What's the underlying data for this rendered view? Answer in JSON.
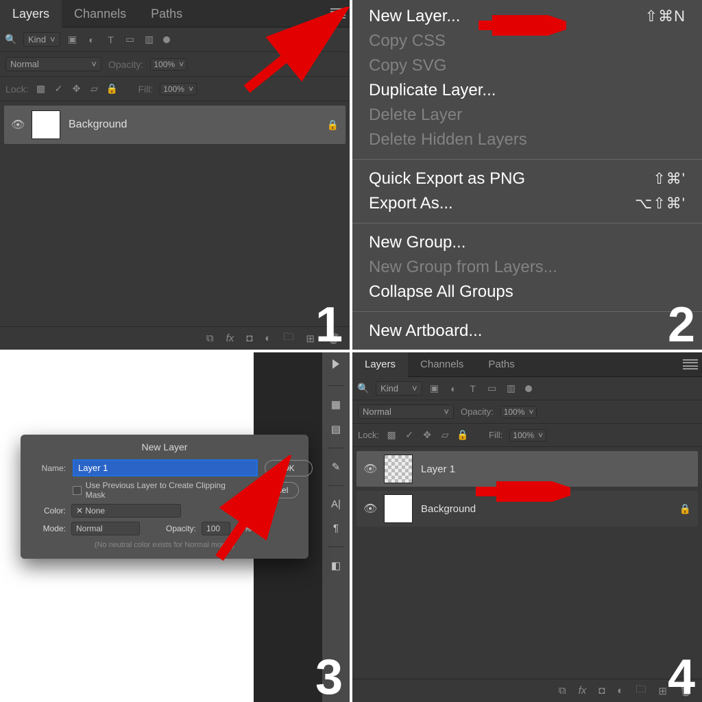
{
  "step_numbers": [
    "1",
    "2",
    "3",
    "4"
  ],
  "panel": {
    "tabs": {
      "layers": "Layers",
      "channels": "Channels",
      "paths": "Paths"
    },
    "filter": {
      "label": "Kind"
    },
    "blend": {
      "mode": "Normal",
      "opacity_label": "Opacity:",
      "opacity_value": "100%",
      "fill_label": "Fill:",
      "fill_value": "100%",
      "lock_label": "Lock:"
    },
    "layers_q1": [
      {
        "name": "Background",
        "locked": true
      }
    ],
    "layers_q4": [
      {
        "name": "Layer 1",
        "locked": false
      },
      {
        "name": "Background",
        "locked": true
      }
    ]
  },
  "menu": {
    "items": [
      {
        "label": "New Layer...",
        "shortcut": "⇧⌘N",
        "enabled": true
      },
      {
        "label": "Copy CSS",
        "enabled": false
      },
      {
        "label": "Copy SVG",
        "enabled": false
      },
      {
        "label": "Duplicate Layer...",
        "enabled": true
      },
      {
        "label": "Delete Layer",
        "enabled": false
      },
      {
        "label": "Delete Hidden Layers",
        "enabled": false
      }
    ],
    "group2": [
      {
        "label": "Quick Export as PNG",
        "shortcut": "⇧⌘'",
        "enabled": true
      },
      {
        "label": "Export As...",
        "shortcut": "⌥⇧⌘'",
        "enabled": true
      }
    ],
    "group3": [
      {
        "label": "New Group...",
        "enabled": true
      },
      {
        "label": "New Group from Layers...",
        "enabled": false
      },
      {
        "label": "Collapse All Groups",
        "enabled": true
      }
    ],
    "group4": [
      {
        "label": "New Artboard...",
        "enabled": true
      }
    ]
  },
  "dialog": {
    "title": "New Layer",
    "name_label": "Name:",
    "name_value": "Layer 1",
    "clip_label": "Use Previous Layer to Create Clipping Mask",
    "color_label": "Color:",
    "color_value": "None",
    "mode_label": "Mode:",
    "mode_value": "Normal",
    "opacity_label": "Opacity:",
    "opacity_value": "100",
    "opacity_pct": "%",
    "note": "(No neutral color exists for Normal mode.)",
    "ok": "OK",
    "cancel": "Cancel"
  }
}
